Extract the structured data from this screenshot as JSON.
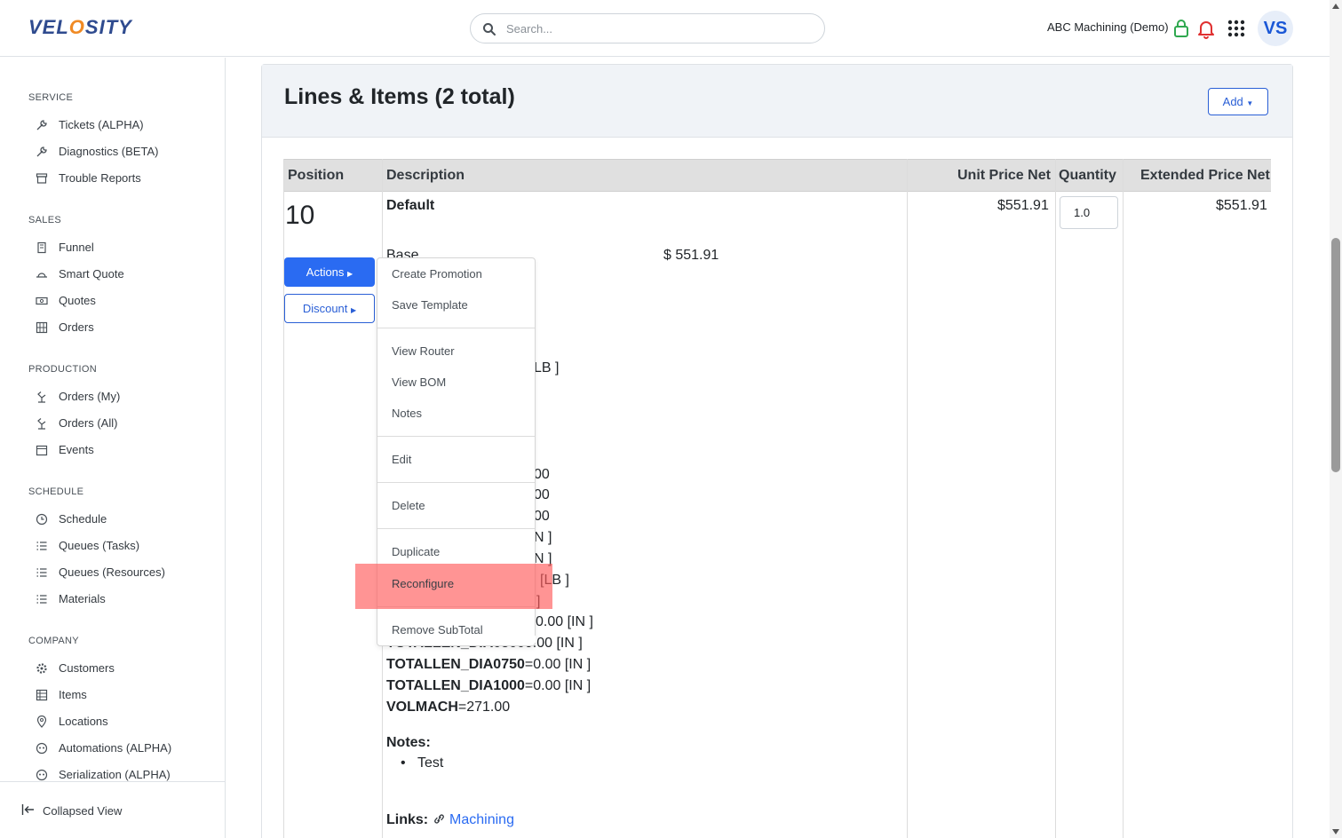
{
  "header": {
    "logo_pre": "VEL",
    "logo_o": "O",
    "logo_post": "SITY",
    "search_placeholder": "Search...",
    "company": "ABC Machining (Demo)",
    "avatar": "VS",
    "icons": [
      "search-icon",
      "lock-icon",
      "bell-icon",
      "apps-grid-icon"
    ],
    "colors": {
      "lock": "#2fa84f",
      "bell": "#e03131",
      "accent": "#2a6bf2"
    }
  },
  "sidebar": {
    "sections": [
      {
        "title": "SERVICE",
        "items": [
          {
            "label": "Tickets (ALPHA)",
            "icon": "wrench-icon"
          },
          {
            "label": "Diagnostics (BETA)",
            "icon": "wrench-icon"
          },
          {
            "label": "Trouble Reports",
            "icon": "archive-icon"
          }
        ]
      },
      {
        "title": "SALES",
        "items": [
          {
            "label": "Funnel",
            "icon": "building-icon"
          },
          {
            "label": "Smart Quote",
            "icon": "hat-icon"
          },
          {
            "label": "Quotes",
            "icon": "money-icon"
          },
          {
            "label": "Orders",
            "icon": "grid-icon"
          }
        ]
      },
      {
        "title": "PRODUCTION",
        "items": [
          {
            "label": "Orders (My)",
            "icon": "robot-arm-icon"
          },
          {
            "label": "Orders (All)",
            "icon": "robot-arm-icon"
          },
          {
            "label": "Events",
            "icon": "calendar-icon"
          }
        ]
      },
      {
        "title": "SCHEDULE",
        "items": [
          {
            "label": "Schedule",
            "icon": "clock-icon"
          },
          {
            "label": "Queues (Tasks)",
            "icon": "list-icon"
          },
          {
            "label": "Queues (Resources)",
            "icon": "list-icon"
          },
          {
            "label": "Materials",
            "icon": "list-icon"
          }
        ]
      },
      {
        "title": "COMPANY",
        "items": [
          {
            "label": "Customers",
            "icon": "gear-icon"
          },
          {
            "label": "Items",
            "icon": "grid-icon"
          },
          {
            "label": "Locations",
            "icon": "pin-icon"
          },
          {
            "label": "Automations (ALPHA)",
            "icon": "robot-icon"
          },
          {
            "label": "Serialization (ALPHA)",
            "icon": "robot-icon"
          }
        ]
      }
    ],
    "collapse_label": "Collapsed View"
  },
  "main": {
    "title": "Lines & Items (2 total)",
    "add_label": "Add",
    "columns": [
      "Position",
      "Description",
      "Unit Price Net",
      "Quantity",
      "Extended Price Net"
    ],
    "row": {
      "position": "10",
      "actions_label": "Actions",
      "discount_label": "Discount",
      "description_title": "Default",
      "base_label": "Base",
      "base_price": "$ 551.91",
      "unit_price": "$551.91",
      "quantity": "1.0",
      "extended_price": "$551.91",
      "fragments": [
        "LB ]",
        "00",
        "00",
        "00",
        "N ]",
        "N ]",
        "[LB ]",
        "]"
      ],
      "partial_lines": [
        {
          "name": "",
          "value": "0.00 [IN ]"
        },
        {
          "name": "TOTALLEN_DIA0500",
          "value": "0.00 [IN ]"
        }
      ],
      "attrs": [
        {
          "name": "TOTALLEN_DIA0750",
          "value": "=0.00 [IN ]"
        },
        {
          "name": "TOTALLEN_DIA1000",
          "value": "=0.00 [IN ]"
        },
        {
          "name": "VOLMACH",
          "value": "=271.00"
        }
      ],
      "notes_label": "Notes:",
      "notes": [
        "Test"
      ],
      "links_label": "Links:",
      "link_text": "Machining"
    }
  },
  "menu": {
    "items": [
      "Create Promotion",
      "Save Template",
      "View Router",
      "View BOM",
      "Notes",
      "Edit",
      "Delete",
      "Duplicate",
      "Reconfigure",
      "Remove SubTotal"
    ],
    "highlighted": "Reconfigure",
    "highlight_color": "#ff5a5a"
  }
}
